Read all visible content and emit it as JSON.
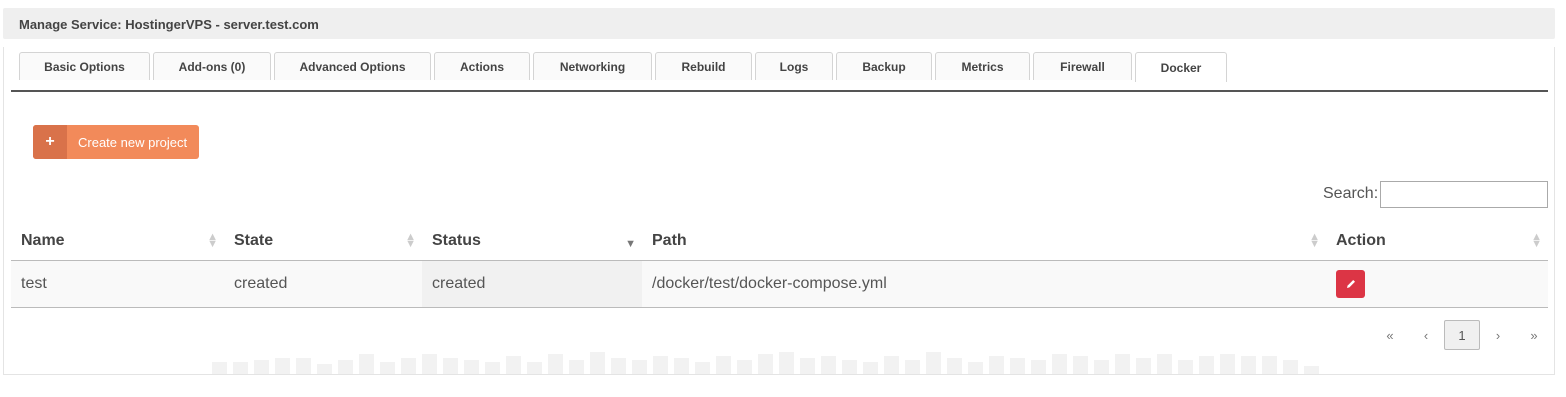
{
  "header": {
    "title": "Manage Service: HostingerVPS - server.test.com"
  },
  "tabs": [
    {
      "label": "Basic Options"
    },
    {
      "label": "Add-ons (0)"
    },
    {
      "label": "Advanced Options"
    },
    {
      "label": "Actions"
    },
    {
      "label": "Networking"
    },
    {
      "label": "Rebuild"
    },
    {
      "label": "Logs"
    },
    {
      "label": "Backup"
    },
    {
      "label": "Metrics"
    },
    {
      "label": "Firewall"
    },
    {
      "label": "Docker",
      "active": true
    }
  ],
  "toolbar": {
    "create_label": "Create new project",
    "create_icon": "+"
  },
  "search": {
    "label": "Search:",
    "value": ""
  },
  "table": {
    "columns": [
      "Name",
      "State",
      "Status",
      "Path",
      "Action"
    ],
    "rows": [
      {
        "name": "test",
        "state": "created",
        "status": "created",
        "path": "/docker/test/docker-compose.yml",
        "action_icon": "pencil-icon"
      }
    ]
  },
  "pagination": {
    "first": "«",
    "prev": "‹",
    "current": "1",
    "next": "›",
    "last": "»"
  },
  "colors": {
    "accent": "#f28a5a",
    "accent_dark": "#d9724a",
    "danger": "#dc3545"
  }
}
